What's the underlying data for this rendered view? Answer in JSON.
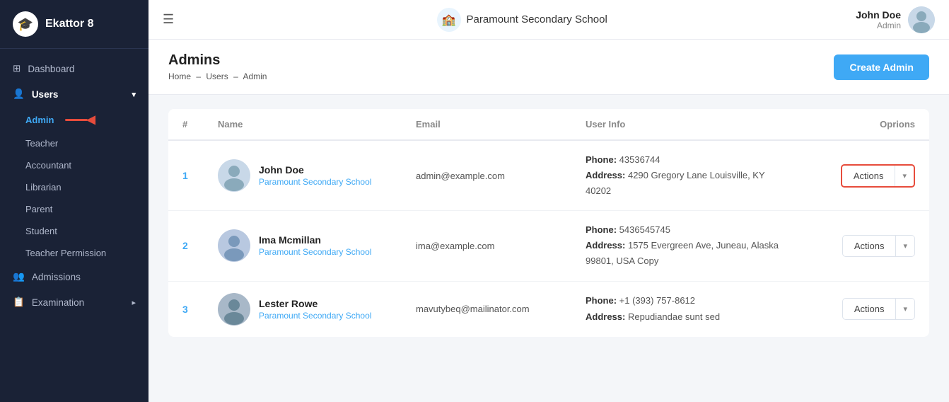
{
  "app": {
    "name": "Ekattor 8",
    "logo_icon": "🎓"
  },
  "topbar": {
    "school_icon": "🏫",
    "school_name": "Paramount Secondary School",
    "user_name": "John Doe",
    "user_role": "Admin",
    "user_avatar": "👤"
  },
  "sidebar": {
    "items": [
      {
        "id": "dashboard",
        "label": "Dashboard",
        "icon": "⊞",
        "type": "main"
      },
      {
        "id": "users",
        "label": "Users",
        "icon": "👤",
        "type": "main",
        "expanded": true
      },
      {
        "id": "admin",
        "label": "Admin",
        "type": "sub",
        "active": true
      },
      {
        "id": "teacher",
        "label": "Teacher",
        "type": "sub"
      },
      {
        "id": "accountant",
        "label": "Accountant",
        "type": "sub"
      },
      {
        "id": "librarian",
        "label": "Librarian",
        "type": "sub"
      },
      {
        "id": "parent",
        "label": "Parent",
        "type": "sub"
      },
      {
        "id": "student",
        "label": "Student",
        "type": "sub"
      },
      {
        "id": "teacher-permission",
        "label": "Teacher Permission",
        "type": "sub"
      },
      {
        "id": "admissions",
        "label": "Admissions",
        "icon": "👥",
        "type": "main"
      },
      {
        "id": "examination",
        "label": "Examination",
        "icon": "📋",
        "type": "main",
        "has_arrow": true
      }
    ]
  },
  "page": {
    "title": "Admins",
    "breadcrumb": [
      "Home",
      "Users",
      "Admin"
    ],
    "create_button": "Create Admin"
  },
  "table": {
    "headers": [
      "#",
      "Name",
      "Email",
      "User Info",
      "Oprions"
    ],
    "rows": [
      {
        "num": "1",
        "name": "John Doe",
        "school": "Paramount Secondary School",
        "email": "admin@example.com",
        "phone": "43536744",
        "address": "4290 Gregory Lane Louisville, KY 40202",
        "avatar": "👨‍💼",
        "actions_label": "Actions",
        "highlighted": true
      },
      {
        "num": "2",
        "name": "Ima Mcmillan",
        "school": "Paramount Secondary School",
        "email": "ima@example.com",
        "phone": "5436545745",
        "address": "1575 Evergreen Ave, Juneau, Alaska 99801, USA Copy",
        "avatar": "👩‍💼",
        "actions_label": "Actions",
        "highlighted": false
      },
      {
        "num": "3",
        "name": "Lester Rowe",
        "school": "Paramount Secondary School",
        "email": "mavutybeq@mailinator.com",
        "phone": "+1 (393) 757-8612",
        "address": "Repudiandae sunt sed",
        "avatar": "👨",
        "actions_label": "Actions",
        "highlighted": false
      }
    ]
  }
}
